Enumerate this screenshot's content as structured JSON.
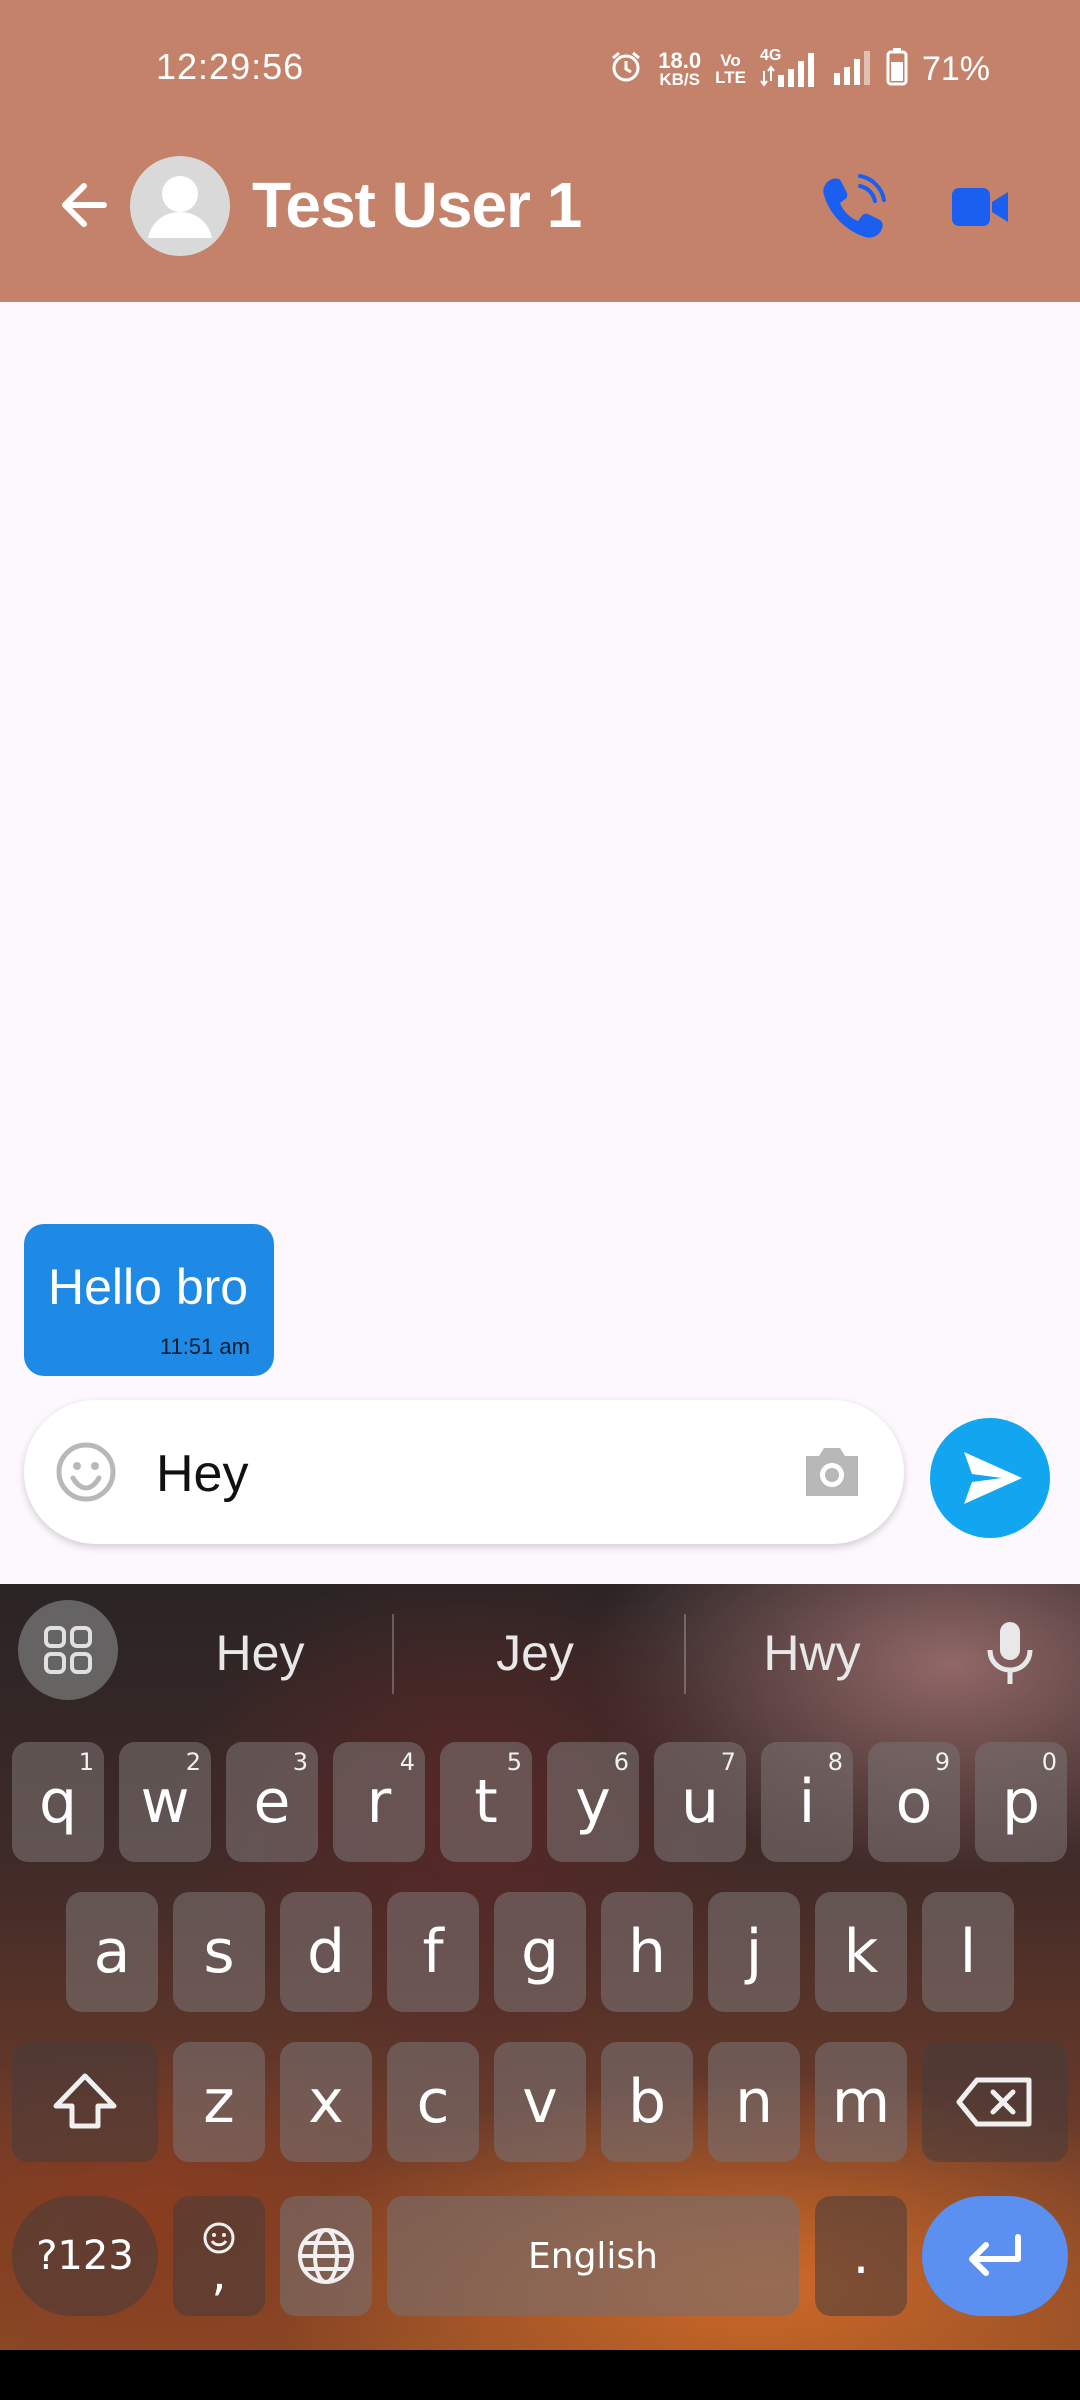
{
  "status_bar": {
    "time": "12:29:56",
    "net_speed_top": "18.0",
    "net_speed_bottom": "KB/S",
    "volte_top": "Vo",
    "volte_bottom": "LTE",
    "network_type": "4G",
    "battery_percent": "71%"
  },
  "header": {
    "contact_name": "Test User 1"
  },
  "messages": [
    {
      "text": "Hello bro",
      "time": "11:51 am"
    }
  ],
  "composer": {
    "text": "Hey"
  },
  "keyboard": {
    "suggestions": [
      "Hey",
      "Jey",
      "Hwy"
    ],
    "row1": [
      {
        "letter": "q",
        "hint": "1"
      },
      {
        "letter": "w",
        "hint": "2"
      },
      {
        "letter": "e",
        "hint": "3"
      },
      {
        "letter": "r",
        "hint": "4"
      },
      {
        "letter": "t",
        "hint": "5"
      },
      {
        "letter": "y",
        "hint": "6"
      },
      {
        "letter": "u",
        "hint": "7"
      },
      {
        "letter": "i",
        "hint": "8"
      },
      {
        "letter": "o",
        "hint": "9"
      },
      {
        "letter": "p",
        "hint": "0"
      }
    ],
    "row2": [
      "a",
      "s",
      "d",
      "f",
      "g",
      "h",
      "j",
      "k",
      "l"
    ],
    "row3": [
      "z",
      "x",
      "c",
      "v",
      "b",
      "n",
      "m"
    ],
    "symbols_label": "?123",
    "comma_label": ",",
    "space_label": "English",
    "period_label": "."
  },
  "colors": {
    "header_bg": "#c4826a",
    "bubble_bg": "#1f8ae6",
    "send_bg": "#12a5f0",
    "call_icon": "#1a5ff0",
    "enter_key": "#5b8ff0"
  }
}
